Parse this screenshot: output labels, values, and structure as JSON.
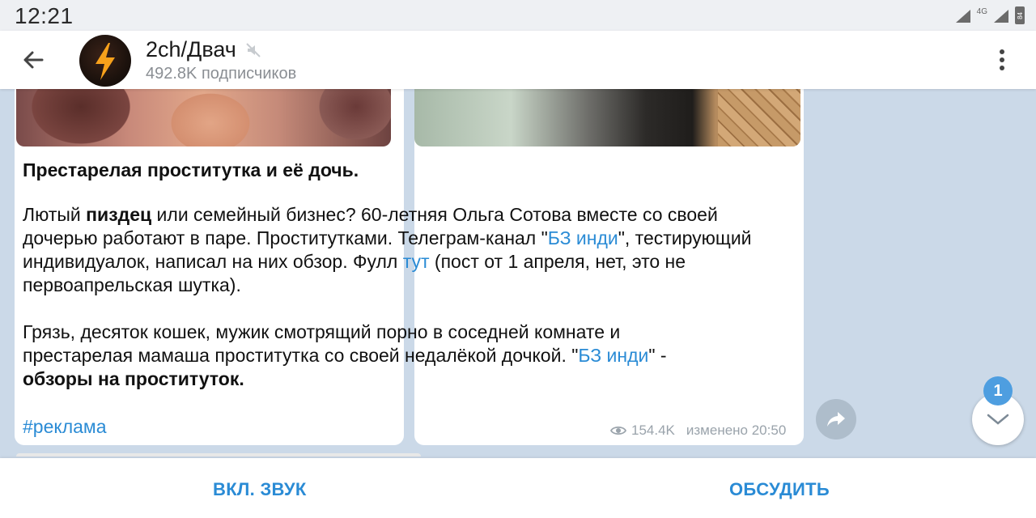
{
  "status_bar": {
    "time": "12:21",
    "network": "4G",
    "battery": "84"
  },
  "header": {
    "channel_name": "2ch/Двач",
    "subscribers": "492.8K подписчиков",
    "icons": {
      "back": "arrow-left-icon",
      "muted": "muted-speaker-icon",
      "menu": "more-vert-icon"
    }
  },
  "post": {
    "title": "Престарелая проститутка и её дочь.",
    "p1_a": "Лютый ",
    "p1_bold": "пиздец",
    "p1_b": " или семейный бизнес? 60-летняя Ольга Сотова вместе со своей дочерью работают в паре. Проститутками. Телеграм-канал \"",
    "p1_link1": "БЗ инди",
    "p1_c": "\", тестирующий индивидуалок, написал на них обзор. Фулл ",
    "p1_link2": "тут",
    "p1_d": " (пост от 1 апреля, нет, это не первоапрельская шутка).",
    "p2_a": "Грязь, десяток кошек, мужик смотрящий порно в соседней комнате и престарелая мамаша проститутка со своей недалёкой дочкой. \"",
    "p2_link": "БЗ инди",
    "p2_b": "\" - ",
    "p2_bold": "обзоры на проституток.",
    "hashtag": "#реклама",
    "views": "154.4K",
    "edited": "изменено 20:50"
  },
  "floating": {
    "unread_count": "1"
  },
  "bottom_bar": {
    "unmute_label": "ВКЛ. ЗВУК",
    "discuss_label": "ОБСУДИТЬ"
  },
  "colors": {
    "accent": "#2a8bd5",
    "chat_background": "#cbd9e8",
    "badge": "#4e9ee0"
  }
}
